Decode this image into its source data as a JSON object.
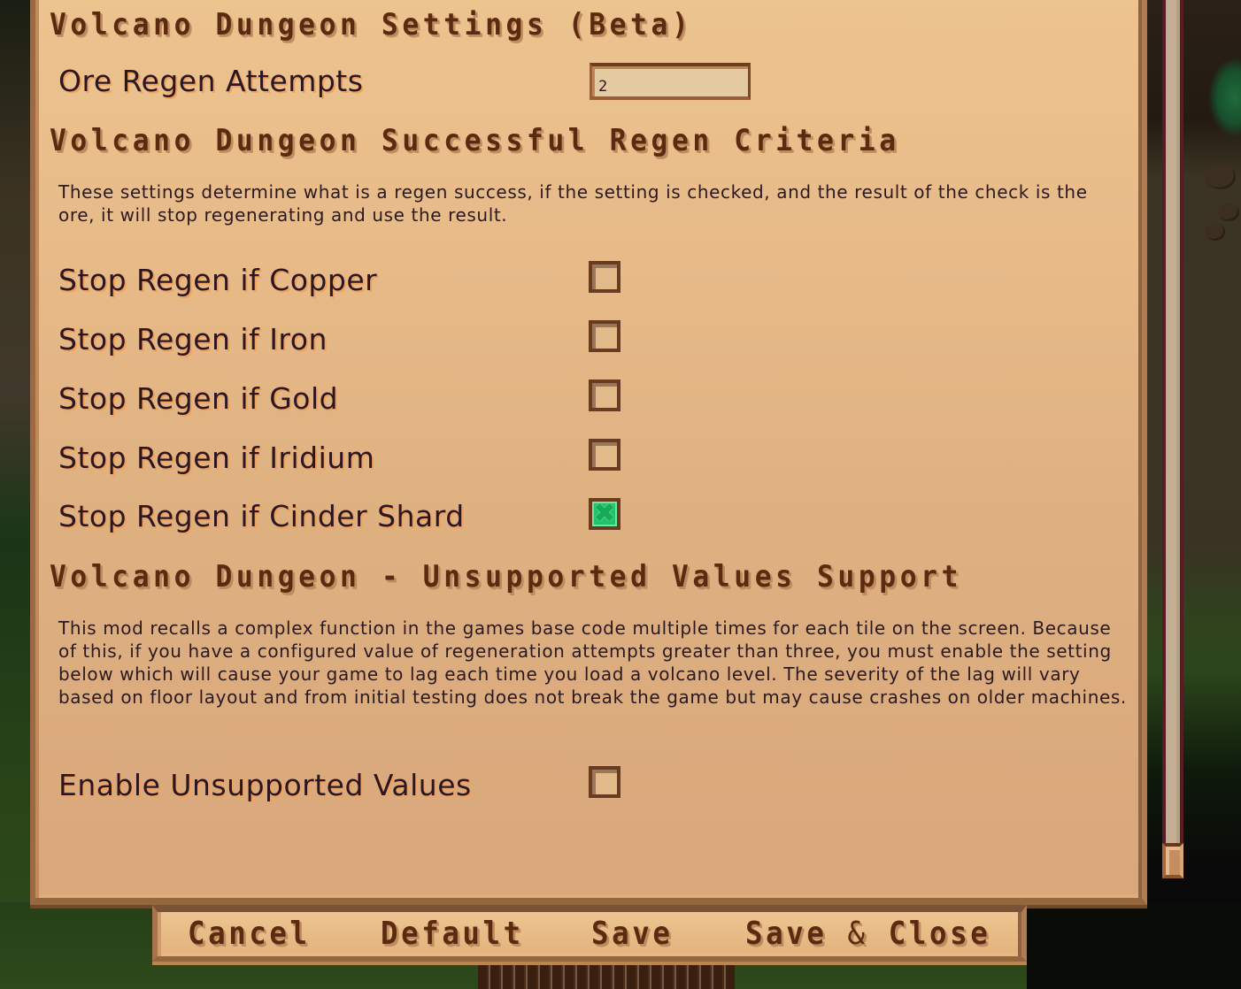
{
  "sections": {
    "settings": {
      "title": "Volcano Dungeon Settings (Beta)",
      "ore_regen_attempts": {
        "label": "Ore Regen Attempts",
        "value": "2"
      }
    },
    "criteria": {
      "title": "Volcano Dungeon Successful Regen Criteria",
      "description": "These settings determine what is a regen success, if the setting is checked, and the result of the check is the ore, it will stop regenerating and use the result.",
      "options": [
        {
          "label": "Stop Regen if Copper",
          "checked": false
        },
        {
          "label": "Stop Regen if Iron",
          "checked": false
        },
        {
          "label": "Stop Regen if Gold",
          "checked": false
        },
        {
          "label": "Stop Regen if Iridium",
          "checked": false
        },
        {
          "label": "Stop Regen if Cinder Shard",
          "checked": true
        }
      ]
    },
    "unsupported": {
      "title": "Volcano Dungeon - Unsupported Values Support",
      "description": "This mod recalls a complex function in the games base code multiple times for each tile on the screen. Because of this, if you have a configured value of regeneration attempts greater than three, you must enable the setting below which will cause your game to lag each time you load a volcano level. The severity of the lag will vary based on floor layout and from initial testing does not break the game but may cause crashes on older machines.",
      "enable_option": {
        "label": "Enable Unsupported Values",
        "checked": false
      }
    }
  },
  "buttons": {
    "cancel": "Cancel",
    "default": "Default",
    "save": "Save",
    "save_close_a": "Save",
    "save_close_amp": "&",
    "save_close_b": "Close"
  },
  "icons": {
    "checked_mark": "✖"
  },
  "colors": {
    "panel_bg": "#e7ba88",
    "heading_text": "#5a2b10",
    "label_text": "#2b1621",
    "checkbox_border": "#683b22",
    "checked_fill": "#22c26a"
  }
}
